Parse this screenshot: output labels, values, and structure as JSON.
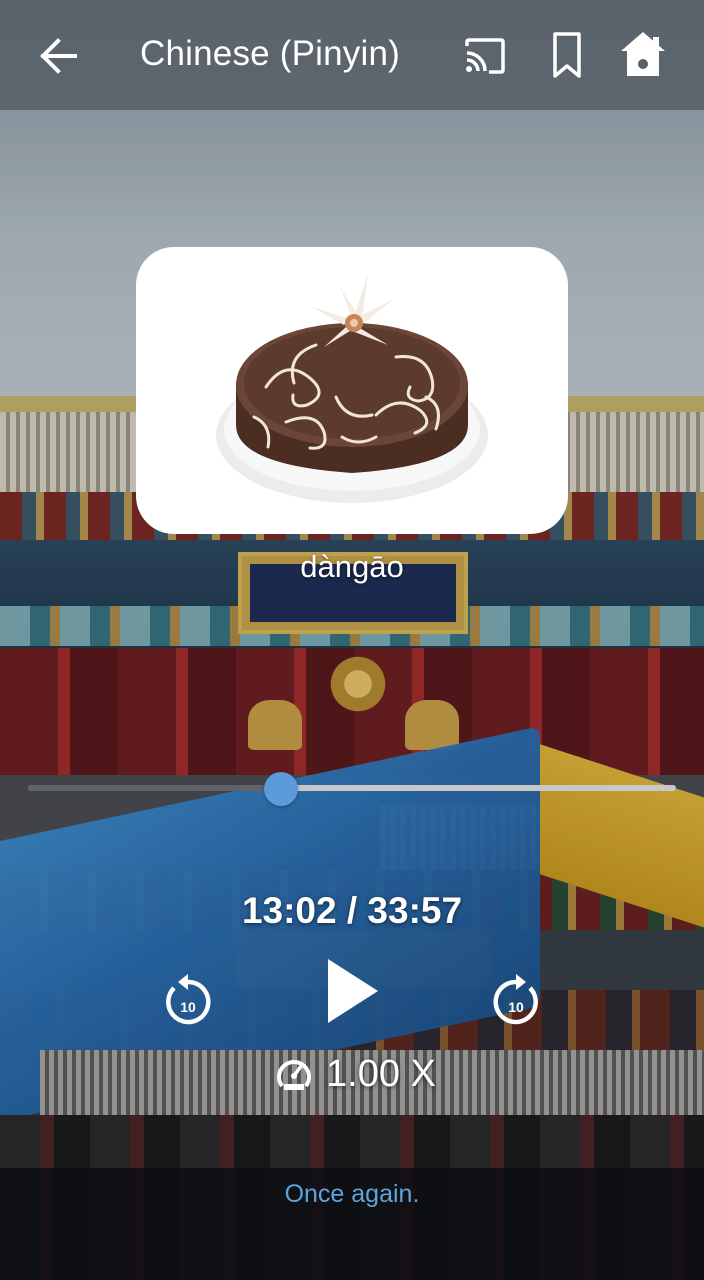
{
  "header": {
    "title": "Chinese (Pinyin)",
    "icons": [
      "back-arrow-icon",
      "cast-icon",
      "bookmark-icon",
      "home-icon"
    ]
  },
  "card": {
    "image": "chocolate-cake",
    "word": "dàngāo"
  },
  "player": {
    "progress_fraction": 0.39,
    "time_label": "13:02 / 33:57",
    "rewind_seconds": "10",
    "forward_seconds": "10",
    "speed_label": "1.00 X"
  },
  "footer": {
    "again_label": "Once again."
  },
  "colors": {
    "accent": "#5b9bd9",
    "link": "#5fa3dd",
    "topbar": "#586068"
  }
}
